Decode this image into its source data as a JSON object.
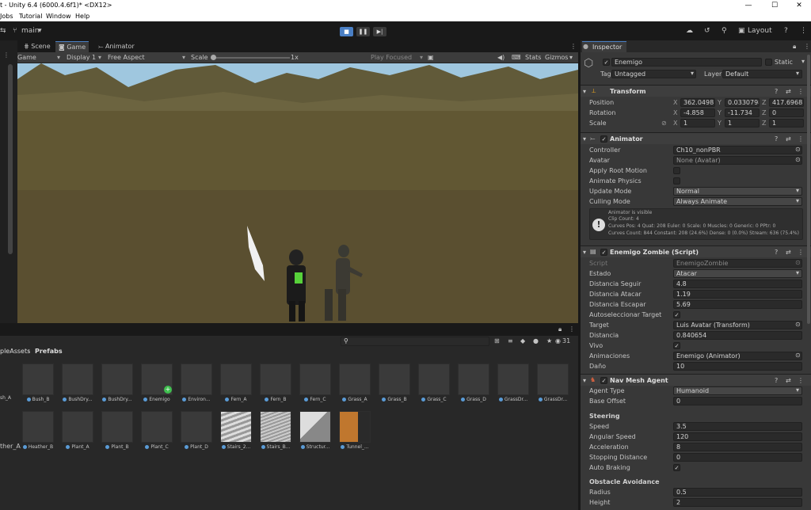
{
  "window": {
    "title": "t - Unity 6.4 (6000.4.6f1)* <DX12>",
    "minimize": "—",
    "maximize": "☐",
    "close": "✕"
  },
  "menu": [
    "Jobs",
    "Tutorial",
    "Window",
    "Help"
  ],
  "toolbar": {
    "branch": "main",
    "layout": "Layout"
  },
  "scene_tabs": [
    "Scene",
    "Game",
    "Animator"
  ],
  "game_bar": {
    "display_mode": "Game",
    "display": "Display 1",
    "aspect": "Free Aspect",
    "scale_label": "Scale",
    "scale_value": "1x",
    "play_focused": "Play Focused",
    "stats": "Stats",
    "gizmos": "Gizmos"
  },
  "project": {
    "search_count": "31",
    "breadcrumb_parent": "pleAssets",
    "breadcrumb_current": "Prefabs",
    "row1": [
      "sh_A",
      "Bush_B",
      "BushDry...",
      "BushDry...",
      "Enemigo",
      "Environ...",
      "Fern_A",
      "Fern_B",
      "Fern_C",
      "Grass_A",
      "Grass_B",
      "Grass_C",
      "Grass_D",
      "GrassDr...",
      "GrassDr..."
    ],
    "row2": [
      "ther_A",
      "Heather_B",
      "Plant_A",
      "Plant_B",
      "Plant_C",
      "Plant_D",
      "Stairs_2...",
      "Stairs_B...",
      "Structur...",
      "Tunnel_..."
    ]
  },
  "inspector": {
    "tab": "Inspector",
    "object_name": "Enemigo",
    "static_label": "Static",
    "tag_label": "Tag",
    "tag_value": "Untagged",
    "layer_label": "Layer",
    "layer_value": "Default",
    "transform": {
      "title": "Transform",
      "position": {
        "label": "Position",
        "x": "362.0498",
        "y": "0.0330798",
        "z": "417.6968"
      },
      "rotation": {
        "label": "Rotation",
        "x": "-4.858",
        "y": "-11.734",
        "z": "0"
      },
      "scale": {
        "label": "Scale",
        "x": "1",
        "y": "1",
        "z": "1"
      }
    },
    "animator": {
      "title": "Animator",
      "controller_label": "Controller",
      "controller": "Ch10_nonPBR",
      "avatar_label": "Avatar",
      "avatar": "None (Avatar)",
      "apply_root_motion": "Apply Root Motion",
      "animate_physics": "Animate Physics",
      "update_mode_label": "Update Mode",
      "update_mode": "Normal",
      "culling_mode_label": "Culling Mode",
      "culling_mode": "Always Animate",
      "info": [
        "Animator is visible",
        "Clip Count: 4",
        "Curves Pos: 4 Quat: 208 Euler: 0 Scale: 0 Muscles: 0 Generic: 0 PPtr: 0",
        "Curves Count: 844 Constant: 208 (24.6%) Dense: 0 (0.0%) Stream: 636 (75.4%)"
      ]
    },
    "script_comp": {
      "title": "Enemigo Zombie (Script)",
      "script_label": "Script",
      "script": "EnemigoZombie",
      "estado_label": "Estado",
      "estado": "Atacar",
      "seguir_label": "Distancia Seguir",
      "seguir": "4.8",
      "atacar_label": "Distancia Atacar",
      "atacar": "1.19",
      "escapar_label": "Distancia Escapar",
      "escapar": "5.69",
      "auto_label": "Autoseleccionar Target",
      "target_label": "Target",
      "target": "Luis Avatar (Transform)",
      "distancia_label": "Distancia",
      "distancia": "0.840654",
      "vivo_label": "Vivo",
      "animaciones_label": "Animaciones",
      "animaciones": "Enemigo (Animator)",
      "dano_label": "Daño",
      "dano": "10"
    },
    "nav": {
      "title": "Nav Mesh Agent",
      "agent_type_label": "Agent Type",
      "agent_type": "Humanoid",
      "base_offset_label": "Base Offset",
      "base_offset": "0",
      "steering": "Steering",
      "speed_label": "Speed",
      "speed": "3.5",
      "angular_label": "Angular Speed",
      "angular": "120",
      "accel_label": "Acceleration",
      "accel": "8",
      "stopping_label": "Stopping Distance",
      "stopping": "0",
      "braking_label": "Auto Braking",
      "obstacle": "Obstacle Avoidance",
      "radius_label": "Radius",
      "radius": "0.5",
      "height_label": "Height",
      "height": "2"
    }
  },
  "colors": {
    "accent": "#4a7fc4",
    "panel": "#383838",
    "dark": "#191919"
  }
}
